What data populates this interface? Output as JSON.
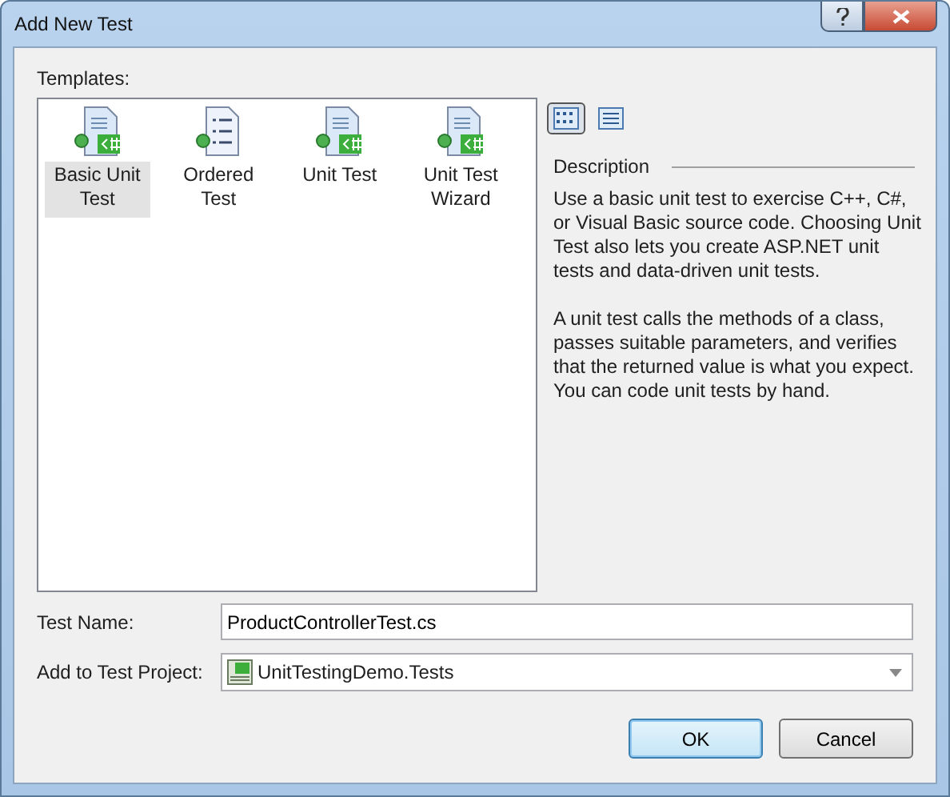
{
  "window": {
    "title": "Add New Test"
  },
  "templates_label": "Templates:",
  "templates": [
    {
      "label": "Basic Unit Test",
      "kind": "csharp",
      "selected": true
    },
    {
      "label": "Ordered Test",
      "kind": "ordered",
      "selected": false
    },
    {
      "label": "Unit Test",
      "kind": "csharp",
      "selected": false
    },
    {
      "label": "Unit Test Wizard",
      "kind": "csharp",
      "selected": false
    }
  ],
  "view_buttons": [
    {
      "kind": "icons",
      "selected": true
    },
    {
      "kind": "list",
      "selected": false
    }
  ],
  "description": {
    "heading": "Description",
    "paragraphs": [
      "Use a basic unit test to exercise C++, C#, or Visual Basic source code. Choosing Unit Test also lets you create ASP.NET unit tests and data-driven unit tests.",
      "A unit test calls the methods of a class, passes suitable parameters, and verifies that the returned value is what you expect. You can code unit tests by hand."
    ]
  },
  "test_name": {
    "label": "Test Name:",
    "value": "ProductControllerTest.cs"
  },
  "test_project": {
    "label": "Add to Test Project:",
    "value": "UnitTestingDemo.Tests"
  },
  "buttons": [
    "OK",
    "Cancel"
  ]
}
